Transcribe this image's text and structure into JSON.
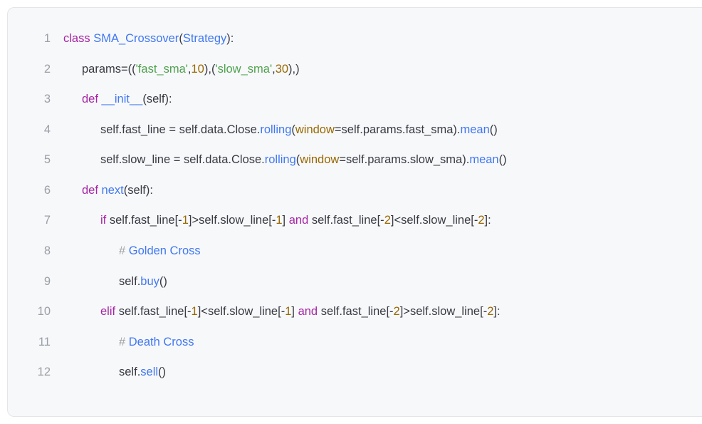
{
  "code": {
    "lines": [
      {
        "no": "1",
        "indent": 0,
        "tokens": [
          {
            "t": "class ",
            "c": "kw-purple"
          },
          {
            "t": "SMA_Crossover",
            "c": "fn-blue"
          },
          {
            "t": "(",
            "c": "punct"
          },
          {
            "t": "Strategy",
            "c": "fn-blue"
          },
          {
            "t": "):",
            "c": "punct"
          }
        ]
      },
      {
        "no": "2",
        "indent": 1,
        "tokens": [
          {
            "t": "params",
            "c": "txt"
          },
          {
            "t": "=((",
            "c": "punct"
          },
          {
            "t": "'fast_sma'",
            "c": "str-green"
          },
          {
            "t": ",",
            "c": "punct"
          },
          {
            "t": "10",
            "c": "num-brown"
          },
          {
            "t": "),(",
            "c": "punct"
          },
          {
            "t": "'slow_sma'",
            "c": "str-green"
          },
          {
            "t": ",",
            "c": "punct"
          },
          {
            "t": "30",
            "c": "num-brown"
          },
          {
            "t": "),)",
            "c": "punct"
          }
        ]
      },
      {
        "no": "3",
        "indent": 1,
        "tokens": [
          {
            "t": "def ",
            "c": "kw-purple"
          },
          {
            "t": "__init__",
            "c": "fn-blue"
          },
          {
            "t": "(",
            "c": "punct"
          },
          {
            "t": "self",
            "c": "txt"
          },
          {
            "t": "):",
            "c": "punct"
          }
        ]
      },
      {
        "no": "4",
        "indent": 2,
        "tokens": [
          {
            "t": "self",
            "c": "txt"
          },
          {
            "t": ".",
            "c": "punct"
          },
          {
            "t": "fast_line ",
            "c": "txt"
          },
          {
            "t": "= ",
            "c": "punct"
          },
          {
            "t": "self",
            "c": "txt"
          },
          {
            "t": ".",
            "c": "punct"
          },
          {
            "t": "data",
            "c": "txt"
          },
          {
            "t": ".",
            "c": "punct"
          },
          {
            "t": "Close",
            "c": "txt"
          },
          {
            "t": ".",
            "c": "punct"
          },
          {
            "t": "rolling",
            "c": "fn-blue"
          },
          {
            "t": "(",
            "c": "punct"
          },
          {
            "t": "window",
            "c": "attr-brown"
          },
          {
            "t": "=",
            "c": "punct"
          },
          {
            "t": "self",
            "c": "txt"
          },
          {
            "t": ".",
            "c": "punct"
          },
          {
            "t": "params",
            "c": "txt"
          },
          {
            "t": ".",
            "c": "punct"
          },
          {
            "t": "fast_sma",
            "c": "txt"
          },
          {
            "t": ").",
            "c": "punct"
          },
          {
            "t": "mean",
            "c": "fn-blue"
          },
          {
            "t": "()",
            "c": "punct"
          }
        ]
      },
      {
        "no": "5",
        "indent": 2,
        "tokens": [
          {
            "t": "self",
            "c": "txt"
          },
          {
            "t": ".",
            "c": "punct"
          },
          {
            "t": "slow_line ",
            "c": "txt"
          },
          {
            "t": "= ",
            "c": "punct"
          },
          {
            "t": "self",
            "c": "txt"
          },
          {
            "t": ".",
            "c": "punct"
          },
          {
            "t": "data",
            "c": "txt"
          },
          {
            "t": ".",
            "c": "punct"
          },
          {
            "t": "Close",
            "c": "txt"
          },
          {
            "t": ".",
            "c": "punct"
          },
          {
            "t": "rolling",
            "c": "fn-blue"
          },
          {
            "t": "(",
            "c": "punct"
          },
          {
            "t": "window",
            "c": "attr-brown"
          },
          {
            "t": "=",
            "c": "punct"
          },
          {
            "t": "self",
            "c": "txt"
          },
          {
            "t": ".",
            "c": "punct"
          },
          {
            "t": "params",
            "c": "txt"
          },
          {
            "t": ".",
            "c": "punct"
          },
          {
            "t": "slow_sma",
            "c": "txt"
          },
          {
            "t": ").",
            "c": "punct"
          },
          {
            "t": "mean",
            "c": "fn-blue"
          },
          {
            "t": "()",
            "c": "punct"
          }
        ]
      },
      {
        "no": "6",
        "indent": 1,
        "tokens": [
          {
            "t": "def ",
            "c": "kw-purple"
          },
          {
            "t": "next",
            "c": "fn-blue"
          },
          {
            "t": "(",
            "c": "punct"
          },
          {
            "t": "self",
            "c": "txt"
          },
          {
            "t": "):",
            "c": "punct"
          }
        ]
      },
      {
        "no": "7",
        "indent": 2,
        "tokens": [
          {
            "t": "if ",
            "c": "kw-purple"
          },
          {
            "t": "self",
            "c": "txt"
          },
          {
            "t": ".",
            "c": "punct"
          },
          {
            "t": "fast_line",
            "c": "txt"
          },
          {
            "t": "[-",
            "c": "punct"
          },
          {
            "t": "1",
            "c": "num-brown"
          },
          {
            "t": "]>",
            "c": "punct"
          },
          {
            "t": "self",
            "c": "txt"
          },
          {
            "t": ".",
            "c": "punct"
          },
          {
            "t": "slow_line",
            "c": "txt"
          },
          {
            "t": "[-",
            "c": "punct"
          },
          {
            "t": "1",
            "c": "num-brown"
          },
          {
            "t": "] ",
            "c": "punct"
          },
          {
            "t": "and ",
            "c": "kw-purple"
          },
          {
            "t": "self",
            "c": "txt"
          },
          {
            "t": ".",
            "c": "punct"
          },
          {
            "t": "fast_line",
            "c": "txt"
          },
          {
            "t": "[-",
            "c": "punct"
          },
          {
            "t": "2",
            "c": "num-brown"
          },
          {
            "t": "]<",
            "c": "punct"
          },
          {
            "t": "self",
            "c": "txt"
          },
          {
            "t": ".",
            "c": "punct"
          },
          {
            "t": "slow_line",
            "c": "txt"
          },
          {
            "t": "[-",
            "c": "punct"
          },
          {
            "t": "2",
            "c": "num-brown"
          },
          {
            "t": "]:",
            "c": "punct"
          }
        ]
      },
      {
        "no": "8",
        "indent": 3,
        "tokens": [
          {
            "t": "# ",
            "c": "comment"
          },
          {
            "t": "Golden Cross",
            "c": "fn-blue"
          }
        ]
      },
      {
        "no": "9",
        "indent": 3,
        "tokens": [
          {
            "t": "self",
            "c": "txt"
          },
          {
            "t": ".",
            "c": "punct"
          },
          {
            "t": "buy",
            "c": "fn-blue"
          },
          {
            "t": "()",
            "c": "punct"
          }
        ]
      },
      {
        "no": "10",
        "indent": 2,
        "tokens": [
          {
            "t": "elif ",
            "c": "kw-purple"
          },
          {
            "t": "self",
            "c": "txt"
          },
          {
            "t": ".",
            "c": "punct"
          },
          {
            "t": "fast_line",
            "c": "txt"
          },
          {
            "t": "[-",
            "c": "punct"
          },
          {
            "t": "1",
            "c": "num-brown"
          },
          {
            "t": "]<",
            "c": "punct"
          },
          {
            "t": "self",
            "c": "txt"
          },
          {
            "t": ".",
            "c": "punct"
          },
          {
            "t": "slow_line",
            "c": "txt"
          },
          {
            "t": "[-",
            "c": "punct"
          },
          {
            "t": "1",
            "c": "num-brown"
          },
          {
            "t": "] ",
            "c": "punct"
          },
          {
            "t": "and ",
            "c": "kw-purple"
          },
          {
            "t": "self",
            "c": "txt"
          },
          {
            "t": ".",
            "c": "punct"
          },
          {
            "t": "fast_line",
            "c": "txt"
          },
          {
            "t": "[-",
            "c": "punct"
          },
          {
            "t": "2",
            "c": "num-brown"
          },
          {
            "t": "]>",
            "c": "punct"
          },
          {
            "t": "self",
            "c": "txt"
          },
          {
            "t": ".",
            "c": "punct"
          },
          {
            "t": "slow_line",
            "c": "txt"
          },
          {
            "t": "[-",
            "c": "punct"
          },
          {
            "t": "2",
            "c": "num-brown"
          },
          {
            "t": "]:",
            "c": "punct"
          }
        ]
      },
      {
        "no": "11",
        "indent": 3,
        "tokens": [
          {
            "t": "# ",
            "c": "comment"
          },
          {
            "t": "Death Cross",
            "c": "fn-blue"
          }
        ]
      },
      {
        "no": "12",
        "indent": 3,
        "tokens": [
          {
            "t": "self",
            "c": "txt"
          },
          {
            "t": ".",
            "c": "punct"
          },
          {
            "t": "sell",
            "c": "fn-blue"
          },
          {
            "t": "()",
            "c": "punct"
          }
        ]
      }
    ]
  }
}
